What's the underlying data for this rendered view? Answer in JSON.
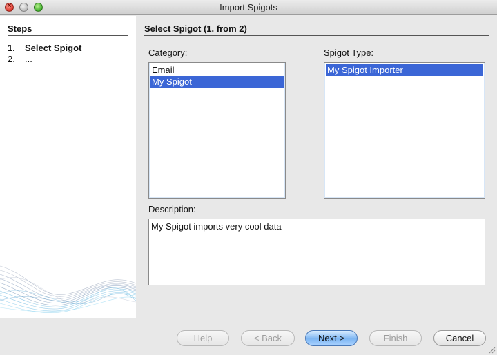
{
  "window": {
    "title": "Import Spigots"
  },
  "steps": {
    "header": "Steps",
    "items": [
      {
        "num": "1.",
        "label": "Select Spigot"
      },
      {
        "num": "2.",
        "label": "..."
      }
    ]
  },
  "main": {
    "header": "Select Spigot (1. from 2)",
    "category": {
      "label": "Category:",
      "items": [
        "Email",
        "My Spigot"
      ],
      "selected": "My Spigot"
    },
    "spigot_type": {
      "label": "Spigot Type:",
      "items": [
        "My Spigot Importer"
      ],
      "selected": "My Spigot Importer"
    },
    "description": {
      "label": "Description:",
      "text": "My Spigot imports very cool data"
    }
  },
  "buttons": {
    "help": "Help",
    "back": "< Back",
    "next": "Next >",
    "finish": "Finish",
    "cancel": "Cancel"
  },
  "colors": {
    "selection": "#3b66d6",
    "default_button": "#7eb6f2",
    "wave": "#4fa8d8"
  }
}
